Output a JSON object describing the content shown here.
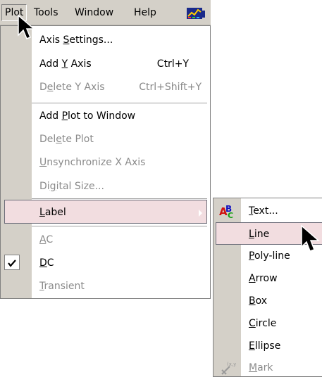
{
  "menubar": {
    "items": [
      "Plot",
      "Tools",
      "Window",
      "Help"
    ],
    "toolbar_icon": "chart-icon"
  },
  "plot_menu": {
    "items": [
      {
        "pre": "Axis ",
        "u": "S",
        "post": "ettings...",
        "shortcut": "",
        "enabled": true
      },
      {
        "pre": "Add ",
        "u": "Y",
        "post": " Axis",
        "shortcut": "Ctrl+Y",
        "enabled": true
      },
      {
        "pre": "D",
        "u": "e",
        "post": "lete Y Axis",
        "shortcut": "Ctrl+Shift+Y",
        "enabled": false
      },
      {
        "pre": "Add ",
        "u": "P",
        "post": "lot to Window",
        "shortcut": "",
        "enabled": true
      },
      {
        "pre": "Del",
        "u": "e",
        "post": "te Plot",
        "shortcut": "",
        "enabled": false
      },
      {
        "pre": "",
        "u": "U",
        "post": "nsynchronize X Axis",
        "shortcut": "",
        "enabled": false
      },
      {
        "pre": "Di",
        "u": "g",
        "post": "ital Size...",
        "shortcut": "",
        "enabled": false
      },
      {
        "pre": "",
        "u": "L",
        "post": "abel",
        "shortcut": "",
        "enabled": true,
        "highlighted": true,
        "submenu": true
      },
      {
        "pre": "",
        "u": "A",
        "post": "C",
        "shortcut": "",
        "enabled": false
      },
      {
        "pre": "",
        "u": "D",
        "post": "C",
        "shortcut": "",
        "enabled": true,
        "checked": true
      },
      {
        "pre": "",
        "u": "T",
        "post": "ransient",
        "shortcut": "",
        "enabled": false
      }
    ]
  },
  "label_submenu": {
    "items": [
      {
        "pre": "",
        "u": "T",
        "post": "ext...",
        "icon": "abc-text-icon",
        "enabled": true
      },
      {
        "pre": "",
        "u": "L",
        "post": "ine",
        "enabled": true,
        "highlighted": true
      },
      {
        "pre": "",
        "u": "P",
        "post": "oly-line",
        "enabled": true
      },
      {
        "pre": "",
        "u": "A",
        "post": "rrow",
        "enabled": true
      },
      {
        "pre": "",
        "u": "B",
        "post": "ox",
        "enabled": true
      },
      {
        "pre": "",
        "u": "C",
        "post": "ircle",
        "enabled": true
      },
      {
        "pre": "",
        "u": "E",
        "post": "llipse",
        "enabled": true
      },
      {
        "pre": "",
        "u": "M",
        "post": "ark",
        "icon": "mark-icon",
        "enabled": false
      }
    ]
  },
  "colors": {
    "menu_face": "#d4d0c8",
    "highlight": "#f2dde0",
    "disabled_text": "#8a8a8a"
  }
}
